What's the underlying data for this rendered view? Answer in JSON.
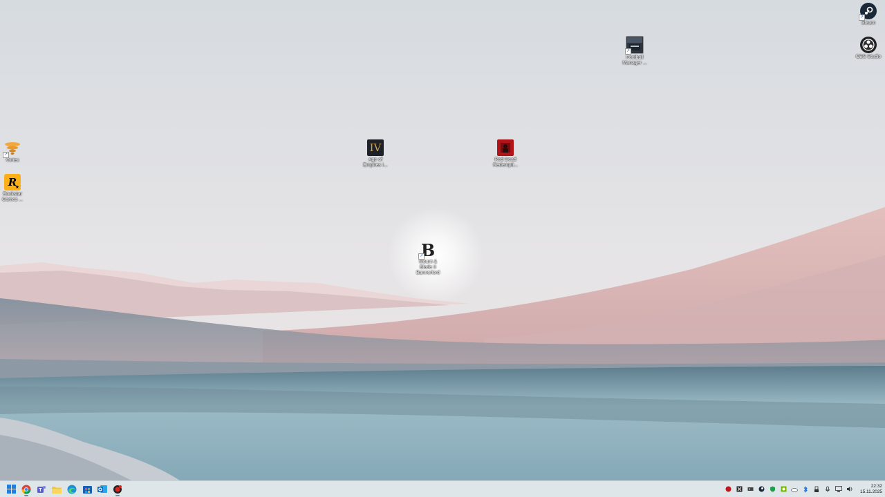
{
  "desktop": {
    "icons": [
      {
        "name": "Steam",
        "label": "Steam"
      },
      {
        "name": "OBS Studio",
        "label": "OBS Studio"
      },
      {
        "name": "Football Manager",
        "label": "Football\nManager ..."
      },
      {
        "name": "Vortex",
        "label": "Vortex"
      },
      {
        "name": "Rockstar Games Launcher",
        "label": "Rockstar\nGames ..."
      },
      {
        "name": "Age of Empires IV",
        "label": "Age of\nEmpires I..."
      },
      {
        "name": "Red Dead Redemption",
        "label": "Red Dead\nRedempti..."
      },
      {
        "name": "Mount & Blade II Bannerlord",
        "label": "Mount &\nBlade II\nBannerlord"
      }
    ]
  },
  "taskbar": {
    "apps": [
      {
        "icon": "windows-start-icon"
      },
      {
        "icon": "chrome-icon"
      },
      {
        "icon": "teams-icon"
      },
      {
        "icon": "file-explorer-icon"
      },
      {
        "icon": "edge-icon"
      },
      {
        "icon": "microsoft-store-icon"
      },
      {
        "icon": "outlook-icon"
      },
      {
        "icon": "app-red-icon"
      }
    ],
    "tray": [
      "red-app-icon",
      "xbox-icon",
      "gpu-icon",
      "steam-icon",
      "shield-icon",
      "nvidia-icon",
      "onedrive-icon",
      "bluetooth-icon",
      "usb-icon",
      "microphone-icon",
      "network-icon",
      "volume-icon"
    ],
    "clock": {
      "time": "22:32",
      "date": "15.11.2025"
    }
  },
  "colors": {
    "taskbar_bg": "#dfe6ea",
    "sky_top": "#d8dde2",
    "dune": "#d9b8b8",
    "water": "#8fb3c2"
  }
}
